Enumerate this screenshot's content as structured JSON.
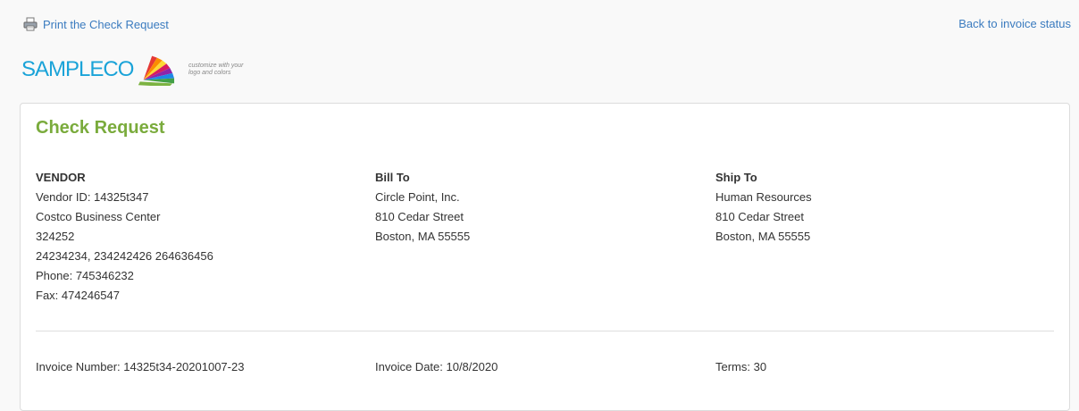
{
  "links": {
    "print": "Print the Check Request",
    "back": "Back to invoice status"
  },
  "logo": {
    "text": "SAMPLECO",
    "tagline": "customize with your logo and colors",
    "colors": [
      "#e53935",
      "#fb8c00",
      "#fdd835",
      "#43a047",
      "#1e88e5",
      "#8e24aa",
      "#d81b60",
      "#7cb342"
    ]
  },
  "card": {
    "title": "Check Request",
    "vendor": {
      "heading": "VENDOR",
      "lines": [
        "Vendor ID: 14325t347",
        "Costco Business Center",
        "324252",
        "24234234, 234242426 264636456",
        "Phone: 745346232",
        "Fax: 474246547"
      ]
    },
    "bill_to": {
      "heading": "Bill To",
      "lines": [
        "Circle Point, Inc.",
        "810 Cedar Street",
        "Boston, MA 55555"
      ]
    },
    "ship_to": {
      "heading": "Ship To",
      "lines": [
        "Human Resources",
        "810 Cedar Street",
        "Boston, MA 55555"
      ]
    },
    "invoice_number": "Invoice Number: 14325t34-20201007-23",
    "invoice_date": "Invoice Date: 10/8/2020",
    "terms": "Terms: 30"
  },
  "colors": {
    "link": "#3a7bbf",
    "title": "#7aab3c",
    "logo_text": "#1aa3d8"
  },
  "icons": {
    "print": "printer-icon"
  }
}
